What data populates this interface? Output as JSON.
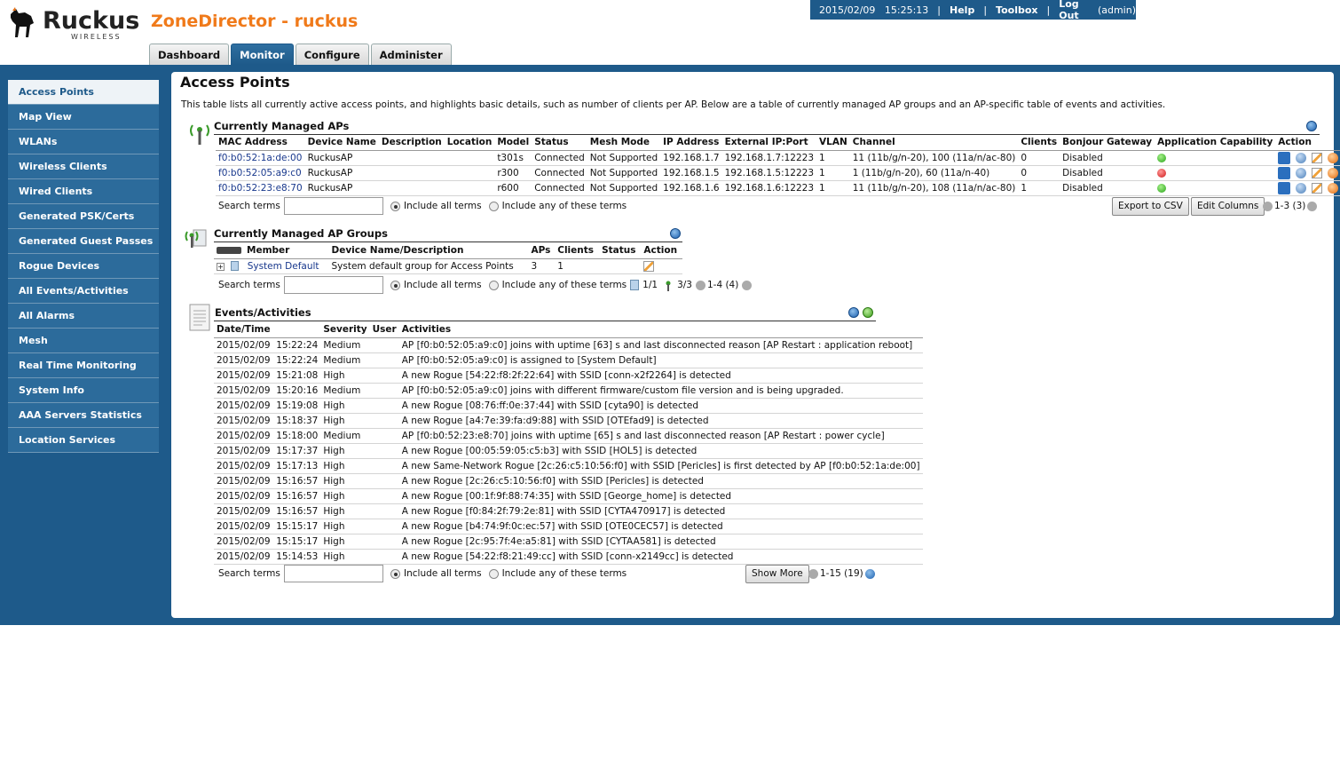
{
  "header": {
    "brand": "Ruckus",
    "brand_sub": "WIRELESS",
    "app_title": "ZoneDirector - ruckus",
    "datetime": "2015/02/09   15:25:13",
    "help": "Help",
    "toolbox": "Toolbox",
    "logout": "Log Out",
    "user": "(admin)"
  },
  "tabs": [
    "Dashboard",
    "Monitor",
    "Configure",
    "Administer"
  ],
  "sidebar": [
    "Access Points",
    "Map View",
    "WLANs",
    "Wireless Clients",
    "Wired Clients",
    "Generated PSK/Certs",
    "Generated Guest Passes",
    "Rogue Devices",
    "All Events/Activities",
    "All Alarms",
    "Mesh",
    "Real Time Monitoring",
    "System Info",
    "AAA Servers Statistics",
    "Location Services"
  ],
  "page": {
    "title": "Access Points",
    "description": "This table lists all currently active access points, and highlights basic details, such as number of clients per AP. Below are a table of currently managed AP groups and an AP-specific table of events and activities."
  },
  "aps": {
    "title": "Currently Managed APs",
    "columns": [
      "MAC Address",
      "Device Name",
      "Description",
      "Location",
      "Model",
      "Status",
      "Mesh Mode",
      "IP Address",
      "External IP:Port",
      "VLAN",
      "Channel",
      "Clients",
      "Bonjour Gateway",
      "Application Capability",
      "Action"
    ],
    "rows": [
      {
        "mac": "f0:b0:52:1a:de:00",
        "name": "RuckusAP",
        "desc": "",
        "loc": "",
        "model": "t301s",
        "status": "Connected",
        "mesh": "Not Supported",
        "ip": "192.168.1.7",
        "ext": "192.168.1.7:12223",
        "vlan": "1",
        "channel": "11 (11b/g/n-20), 100 (11a/n/ac-80)",
        "clients": "0",
        "bonjour": "Disabled",
        "cap": "ok"
      },
      {
        "mac": "f0:b0:52:05:a9:c0",
        "name": "RuckusAP",
        "desc": "",
        "loc": "",
        "model": "r300",
        "status": "Connected",
        "mesh": "Not Supported",
        "ip": "192.168.1.5",
        "ext": "192.168.1.5:12223",
        "vlan": "1",
        "channel": "1 (11b/g/n-20), 60 (11a/n-40)",
        "clients": "0",
        "bonjour": "Disabled",
        "cap": "bad"
      },
      {
        "mac": "f0:b0:52:23:e8:70",
        "name": "RuckusAP",
        "desc": "",
        "loc": "",
        "model": "r600",
        "status": "Connected",
        "mesh": "Not Supported",
        "ip": "192.168.1.6",
        "ext": "192.168.1.6:12223",
        "vlan": "1",
        "channel": "11 (11b/g/n-20), 108 (11a/n/ac-80)",
        "clients": "1",
        "bonjour": "Disabled",
        "cap": "ok"
      }
    ],
    "search_label": "Search terms",
    "include_all": "Include all terms",
    "include_any": "Include any of these terms",
    "export": "Export to CSV",
    "edit_columns": "Edit Columns",
    "pager": "1-3 (3)"
  },
  "groups": {
    "title": "Currently Managed AP Groups",
    "columns": [
      "Member",
      "Device Name/Description",
      "APs",
      "Clients",
      "Status",
      "Action"
    ],
    "rows": [
      {
        "member": "System Default",
        "desc": "System default group for Access Points",
        "aps": "3",
        "clients": "1",
        "status": ""
      }
    ],
    "search_label": "Search terms",
    "include_all": "Include all terms",
    "include_any": "Include any of these terms",
    "count_a": "1/1",
    "count_b": "3/3",
    "pager": "1-4 (4)"
  },
  "events": {
    "title": "Events/Activities",
    "columns": [
      "Date/Time",
      "Severity",
      "User",
      "Activities"
    ],
    "rows": [
      {
        "dt": "2015/02/09  15:22:24",
        "sev": "Medium",
        "user": "",
        "act": "AP [f0:b0:52:05:a9:c0] joins with uptime [63] s and last disconnected reason [AP Restart : application reboot]"
      },
      {
        "dt": "2015/02/09  15:22:24",
        "sev": "Medium",
        "user": "",
        "act": "AP [f0:b0:52:05:a9:c0] is assigned to [System Default]"
      },
      {
        "dt": "2015/02/09  15:21:08",
        "sev": "High",
        "user": "",
        "act": "A new Rogue [54:22:f8:2f:22:64] with SSID [conn-x2f2264] is detected"
      },
      {
        "dt": "2015/02/09  15:20:16",
        "sev": "Medium",
        "user": "",
        "act": "AP [f0:b0:52:05:a9:c0] joins with different firmware/custom file version and is being upgraded."
      },
      {
        "dt": "2015/02/09  15:19:08",
        "sev": "High",
        "user": "",
        "act": "A new Rogue [08:76:ff:0e:37:44] with SSID [cyta90] is detected"
      },
      {
        "dt": "2015/02/09  15:18:37",
        "sev": "High",
        "user": "",
        "act": "A new Rogue [a4:7e:39:fa:d9:88] with SSID [OTEfad9] is detected"
      },
      {
        "dt": "2015/02/09  15:18:00",
        "sev": "Medium",
        "user": "",
        "act": "AP [f0:b0:52:23:e8:70] joins with uptime [65] s and last disconnected reason [AP Restart : power cycle]"
      },
      {
        "dt": "2015/02/09  15:17:37",
        "sev": "High",
        "user": "",
        "act": "A new Rogue [00:05:59:05:c5:b3] with SSID [HOL5] is detected"
      },
      {
        "dt": "2015/02/09  15:17:13",
        "sev": "High",
        "user": "",
        "act": "A new Same-Network Rogue [2c:26:c5:10:56:f0] with SSID [Pericles] is first detected by AP [f0:b0:52:1a:de:00]"
      },
      {
        "dt": "2015/02/09  15:16:57",
        "sev": "High",
        "user": "",
        "act": "A new Rogue [2c:26:c5:10:56:f0] with SSID [Pericles] is detected"
      },
      {
        "dt": "2015/02/09  15:16:57",
        "sev": "High",
        "user": "",
        "act": "A new Rogue [00:1f:9f:88:74:35] with SSID [George_home] is detected"
      },
      {
        "dt": "2015/02/09  15:16:57",
        "sev": "High",
        "user": "",
        "act": "A new Rogue [f0:84:2f:79:2e:81] with SSID [CYTA470917] is detected"
      },
      {
        "dt": "2015/02/09  15:15:17",
        "sev": "High",
        "user": "",
        "act": "A new Rogue [b4:74:9f:0c:ec:57] with SSID [OTE0CEC57] is detected"
      },
      {
        "dt": "2015/02/09  15:15:17",
        "sev": "High",
        "user": "",
        "act": "A new Rogue [2c:95:7f:4e:a5:81] with SSID [CYTAA581] is detected"
      },
      {
        "dt": "2015/02/09  15:14:53",
        "sev": "High",
        "user": "",
        "act": "A new Rogue [54:22:f8:21:49:cc] with SSID [conn-x2149cc] is detected"
      }
    ],
    "search_label": "Search terms",
    "include_all": "Include all terms",
    "include_any": "Include any of these terms",
    "show_more": "Show More",
    "pager": "1-15 (19)"
  },
  "colors": {
    "brand_orange": "#f07a1a",
    "band_blue": "#1e5a8a",
    "link_blue": "#17378c"
  }
}
